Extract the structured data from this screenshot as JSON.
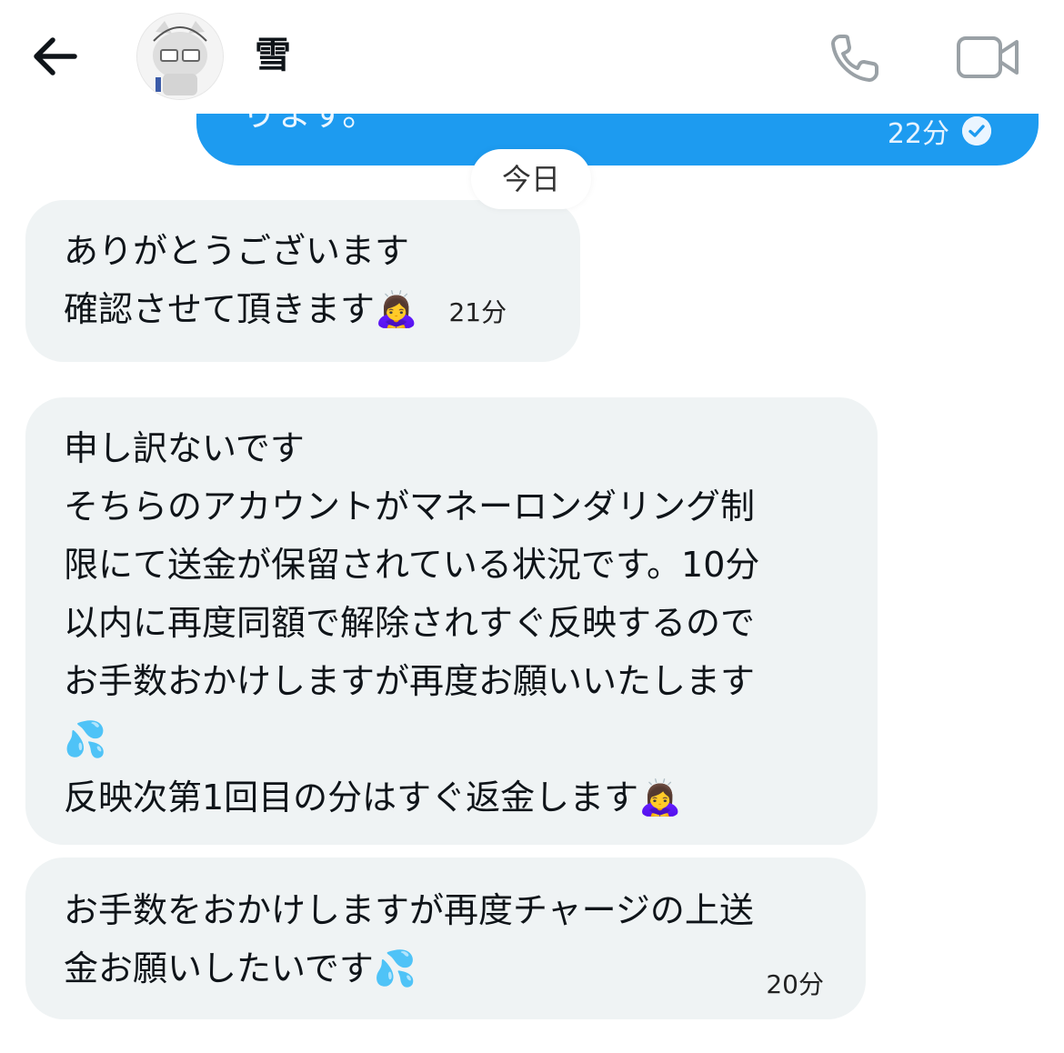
{
  "header": {
    "contact_name": "雪",
    "icons": {
      "back": "arrow-left-icon",
      "call": "phone-icon",
      "video": "video-camera-icon"
    }
  },
  "sent_message": {
    "text_partial": "ります。",
    "time": "22分",
    "status_icon": "read-check-icon"
  },
  "date_separator": "今日",
  "messages": [
    {
      "lines": [
        "ありがとうございます",
        "確認させて頂きます"
      ],
      "emoji": "🙇‍♀️",
      "time": "21分"
    },
    {
      "lines": [
        "申し訳ないです",
        "そちらのアカウントがマネーロンダリング制",
        "限にて送金が保留されている状況です。10分",
        "以内に再度同額で解除されすぐ反映するので",
        "お手数おかけしますが再度お願いいたします",
        "💦",
        "反映次第1回目の分はすぐ返金します"
      ],
      "emoji": "🙇‍♀️"
    },
    {
      "lines": [
        "お手数をおかけしますが再度チャージの上送",
        "金お願いしたいです"
      ],
      "emoji": "💦",
      "time": "20分"
    }
  ],
  "colors": {
    "sent_bubble": "#1d9bf0",
    "received_bubble": "#eff3f4",
    "text": "#0f1419",
    "icon_gray": "#9aa1a6"
  }
}
